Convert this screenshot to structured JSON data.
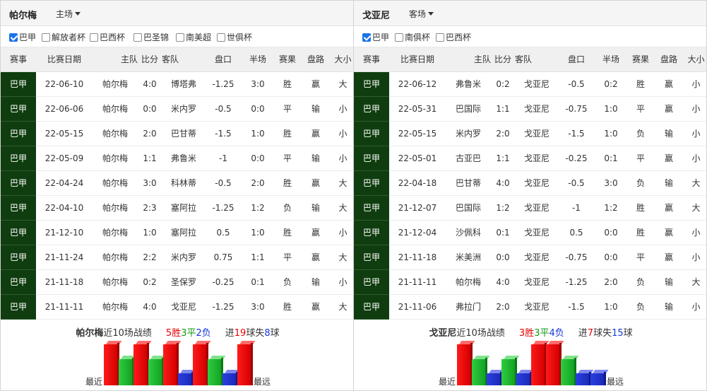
{
  "columns": [
    "赛事",
    "比赛日期",
    "主队",
    "比分",
    "客队",
    "盘口",
    "半场",
    "赛果",
    "盘路",
    "大小"
  ],
  "left": {
    "team": "帕尔梅",
    "venue": "主场",
    "filters": [
      {
        "label": "巴甲",
        "checked": true
      },
      {
        "label": "解放者杯",
        "checked": false
      },
      {
        "label": "巴西杯",
        "checked": false
      },
      {
        "label": "巴圣锦",
        "checked": false
      },
      {
        "label": "南美超",
        "checked": false
      },
      {
        "label": "世俱杯",
        "checked": false
      }
    ],
    "rows": [
      {
        "league": "巴甲",
        "date": "22-06-10",
        "home": "帕尔梅",
        "score": "4:0",
        "away": "博塔弗",
        "handicap": "-1.25",
        "half": "3:0",
        "result": "胜",
        "pan": "赢",
        "size": "大"
      },
      {
        "league": "巴甲",
        "date": "22-06-06",
        "home": "帕尔梅",
        "score": "0:0",
        "away": "米内罗",
        "handicap": "-0.5",
        "half": "0:0",
        "result": "平",
        "pan": "输",
        "size": "小"
      },
      {
        "league": "巴甲",
        "date": "22-05-15",
        "home": "帕尔梅",
        "score": "2:0",
        "away": "巴甘蒂",
        "handicap": "-1.5",
        "half": "1:0",
        "result": "胜",
        "pan": "赢",
        "size": "小"
      },
      {
        "league": "巴甲",
        "date": "22-05-09",
        "home": "帕尔梅",
        "score": "1:1",
        "away": "弗鲁米",
        "handicap": "-1",
        "half": "0:0",
        "result": "平",
        "pan": "输",
        "size": "小"
      },
      {
        "league": "巴甲",
        "date": "22-04-24",
        "home": "帕尔梅",
        "score": "3:0",
        "away": "科林蒂",
        "handicap": "-0.5",
        "half": "2:0",
        "result": "胜",
        "pan": "赢",
        "size": "大"
      },
      {
        "league": "巴甲",
        "date": "22-04-10",
        "home": "帕尔梅",
        "score": "2:3",
        "away": "塞阿拉",
        "handicap": "-1.25",
        "half": "1:2",
        "result": "负",
        "pan": "输",
        "size": "大"
      },
      {
        "league": "巴甲",
        "date": "21-12-10",
        "home": "帕尔梅",
        "score": "1:0",
        "away": "塞阿拉",
        "handicap": "0.5",
        "half": "1:0",
        "result": "胜",
        "pan": "赢",
        "size": "小"
      },
      {
        "league": "巴甲",
        "date": "21-11-24",
        "home": "帕尔梅",
        "score": "2:2",
        "away": "米内罗",
        "handicap": "0.75",
        "half": "1:1",
        "result": "平",
        "pan": "赢",
        "size": "大"
      },
      {
        "league": "巴甲",
        "date": "21-11-18",
        "home": "帕尔梅",
        "score": "0:2",
        "away": "圣保罗",
        "handicap": "-0.25",
        "half": "0:1",
        "result": "负",
        "pan": "输",
        "size": "小"
      },
      {
        "league": "巴甲",
        "date": "21-11-11",
        "home": "帕尔梅",
        "score": "4:0",
        "away": "戈亚尼",
        "handicap": "-1.25",
        "half": "3:0",
        "result": "胜",
        "pan": "赢",
        "size": "大"
      }
    ],
    "summary": {
      "team": "帕尔梅",
      "prefix": "近10场战绩",
      "wins": "5胜",
      "draws": "3平",
      "losses": "2负",
      "goals_label": "进",
      "goals_for": "19",
      "goals_mid": "球失",
      "goals_against": "8",
      "goals_suffix": "球"
    },
    "bars": [
      "W",
      "D",
      "W",
      "D",
      "W",
      "L",
      "W",
      "D",
      "L",
      "W"
    ],
    "recent_label": "最近",
    "far_label": "最远"
  },
  "right": {
    "team": "戈亚尼",
    "venue": "客场",
    "filters": [
      {
        "label": "巴甲",
        "checked": true
      },
      {
        "label": "南俱杯",
        "checked": false
      },
      {
        "label": "巴西杯",
        "checked": false
      }
    ],
    "rows": [
      {
        "league": "巴甲",
        "date": "22-06-12",
        "home": "弗鲁米",
        "score": "0:2",
        "away": "戈亚尼",
        "handicap": "-0.5",
        "half": "0:2",
        "result": "胜",
        "pan": "赢",
        "size": "小"
      },
      {
        "league": "巴甲",
        "date": "22-05-31",
        "home": "巴国际",
        "score": "1:1",
        "away": "戈亚尼",
        "handicap": "-0.75",
        "half": "1:0",
        "result": "平",
        "pan": "赢",
        "size": "小"
      },
      {
        "league": "巴甲",
        "date": "22-05-15",
        "home": "米内罗",
        "score": "2:0",
        "away": "戈亚尼",
        "handicap": "-1.5",
        "half": "1:0",
        "result": "负",
        "pan": "输",
        "size": "小"
      },
      {
        "league": "巴甲",
        "date": "22-05-01",
        "home": "古亚巴",
        "score": "1:1",
        "away": "戈亚尼",
        "handicap": "-0.25",
        "half": "0:1",
        "result": "平",
        "pan": "赢",
        "size": "小"
      },
      {
        "league": "巴甲",
        "date": "22-04-18",
        "home": "巴甘蒂",
        "score": "4:0",
        "away": "戈亚尼",
        "handicap": "-0.5",
        "half": "3:0",
        "result": "负",
        "pan": "输",
        "size": "大"
      },
      {
        "league": "巴甲",
        "date": "21-12-07",
        "home": "巴国际",
        "score": "1:2",
        "away": "戈亚尼",
        "handicap": "-1",
        "half": "1:2",
        "result": "胜",
        "pan": "赢",
        "size": "大"
      },
      {
        "league": "巴甲",
        "date": "21-12-04",
        "home": "沙佩科",
        "score": "0:1",
        "away": "戈亚尼",
        "handicap": "0.5",
        "half": "0:0",
        "result": "胜",
        "pan": "赢",
        "size": "小"
      },
      {
        "league": "巴甲",
        "date": "21-11-18",
        "home": "米美洲",
        "score": "0:0",
        "away": "戈亚尼",
        "handicap": "-0.75",
        "half": "0:0",
        "result": "平",
        "pan": "赢",
        "size": "小"
      },
      {
        "league": "巴甲",
        "date": "21-11-11",
        "home": "帕尔梅",
        "score": "4:0",
        "away": "戈亚尼",
        "handicap": "-1.25",
        "half": "2:0",
        "result": "负",
        "pan": "输",
        "size": "大"
      },
      {
        "league": "巴甲",
        "date": "21-11-06",
        "home": "弗拉门",
        "score": "2:0",
        "away": "戈亚尼",
        "handicap": "-1.5",
        "half": "1:0",
        "result": "负",
        "pan": "输",
        "size": "小"
      }
    ],
    "summary": {
      "team": "戈亚尼",
      "prefix": "近10场战绩",
      "wins": "3胜",
      "draws": "3平",
      "losses": "4负",
      "goals_label": "进",
      "goals_for": "7",
      "goals_mid": "球失",
      "goals_against": "15",
      "goals_suffix": "球"
    },
    "bars": [
      "W",
      "D",
      "L",
      "D",
      "L",
      "W",
      "W",
      "D",
      "L",
      "L"
    ],
    "recent_label": "最近",
    "far_label": "最远"
  }
}
